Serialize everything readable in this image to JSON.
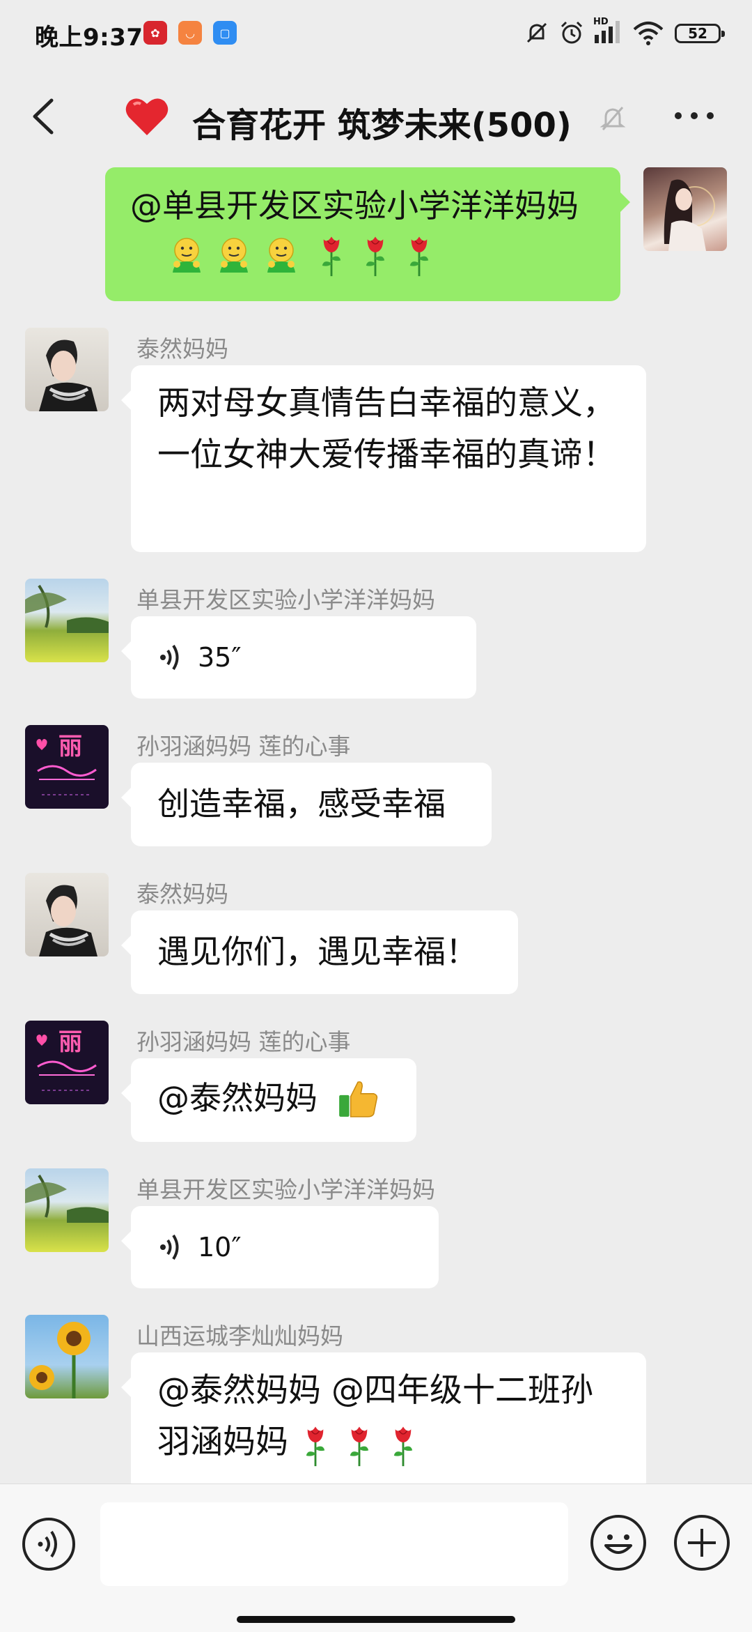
{
  "status_bar": {
    "time": "晚上9:37",
    "app_icons": [
      "app-red-icon",
      "app-orange-icon",
      "app-blue-icon"
    ],
    "signal_label": "HD",
    "battery": "52"
  },
  "header": {
    "title": "合育花开 筑梦未来(500)",
    "icons": {
      "back": "back-arrow-icon",
      "heart": "red-heart-icon",
      "mute": "bell-off-icon",
      "more": "more-dots-icon"
    }
  },
  "messages": [
    {
      "kind": "self",
      "text": "@单县开发区实验小学洋洋妈妈",
      "emojis": [
        "smile",
        "smile",
        "smile",
        "rose",
        "rose",
        "rose"
      ]
    },
    {
      "kind": "other",
      "sender": "泰然妈妈",
      "text": "两对母女真情告白幸福的意义，一位女神大爱传播幸福的真谛！"
    },
    {
      "kind": "voice",
      "sender": "单县开发区实验小学洋洋妈妈",
      "duration": "35″"
    },
    {
      "kind": "other",
      "sender": "孙羽涵妈妈  莲的心事",
      "text": "创造幸福，感受幸福"
    },
    {
      "kind": "other",
      "sender": "泰然妈妈",
      "text": "遇见你们，遇见幸福！"
    },
    {
      "kind": "other",
      "sender": "孙羽涵妈妈  莲的心事",
      "text": "@泰然妈妈",
      "emojis": [
        "thumbs-up"
      ]
    },
    {
      "kind": "voice",
      "sender": "单县开发区实验小学洋洋妈妈",
      "duration": "10″"
    },
    {
      "kind": "other",
      "sender": "山西运城李灿灿妈妈",
      "text": "@泰然妈妈 @四年级十二班孙羽涵妈妈",
      "emojis": [
        "rose",
        "rose",
        "rose"
      ]
    }
  ],
  "avatar_text": {
    "li_avatar": "丽"
  },
  "input_bar": {
    "placeholder": "",
    "icons": {
      "voice": "voice-mode-icon",
      "emoji": "emoji-face-icon",
      "plus": "plus-circle-icon"
    }
  },
  "colors": {
    "background": "#ededed",
    "self_bubble": "#95ec69",
    "other_bubble": "#ffffff",
    "sender_text": "#8a8a8a"
  }
}
